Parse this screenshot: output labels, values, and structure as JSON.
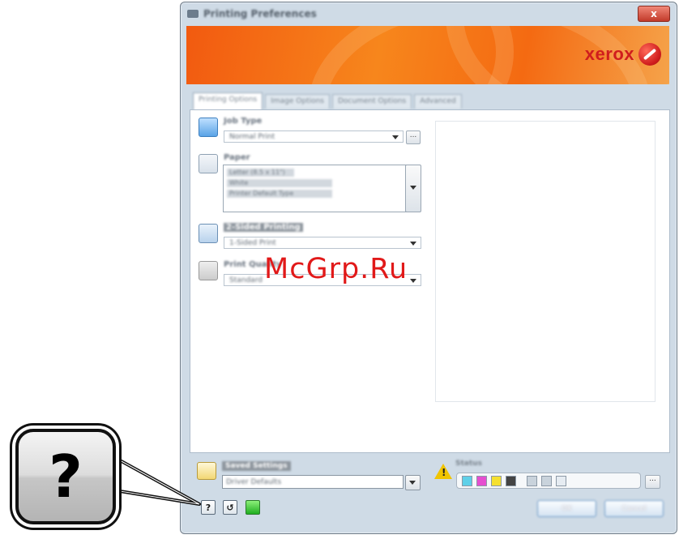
{
  "window": {
    "title": "Printing Preferences",
    "close_label": "x"
  },
  "banner": {
    "logo_text": "xerox"
  },
  "tabs": [
    {
      "label": "Printing Options",
      "active": true
    },
    {
      "label": "Image Options"
    },
    {
      "label": "Document Options"
    },
    {
      "label": "Advanced"
    }
  ],
  "options": {
    "job_type": {
      "label": "Job Type",
      "value": "Normal Print",
      "more_label": "..."
    },
    "paper": {
      "label": "Paper",
      "lines": [
        "Letter (8.5 x 11\")",
        "White",
        "Printer Default Type"
      ]
    },
    "two_sided": {
      "label": "2-Sided Printing",
      "value": "1-Sided Print"
    },
    "quality": {
      "label": "Print Quality",
      "value": "Standard"
    }
  },
  "footer": {
    "saved_settings_label": "Saved Settings",
    "saved_settings_value": "Driver Defaults",
    "status_label": "Status",
    "status_more_label": "...",
    "help_label": "?",
    "reset_label": "↺",
    "ok_label": "OK",
    "cancel_label": "Cancel"
  },
  "callout": {
    "help_symbol": "?"
  },
  "watermark": {
    "text": "McGrp.Ru"
  },
  "colors": {
    "banner_orange": "#f46a12",
    "logo_red": "#d01d1d",
    "watermark_red": "#e11919",
    "eco_green": "#1fae20",
    "warning_yellow": "#f0c400"
  },
  "icons": {
    "job_type": "printer-icon",
    "paper": "paper-icon",
    "two_sided": "two-sided-icon",
    "quality": "quality-icon",
    "saved_settings": "saved-settings-icon",
    "status": "warning-icon",
    "help": "help-icon",
    "reset": "reset-icon",
    "eco": "earth-smart-icon"
  }
}
